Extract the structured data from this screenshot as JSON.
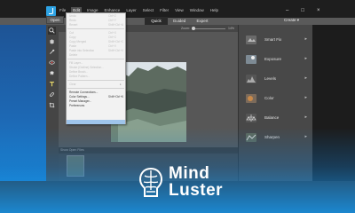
{
  "menubar": {
    "items": [
      "File",
      "Edit",
      "Image",
      "Enhance",
      "Layer",
      "Select",
      "Filter",
      "View",
      "Window",
      "Help"
    ],
    "active_index": 1
  },
  "mode": {
    "open_label": "Open",
    "tabs": [
      "Quick",
      "Guided",
      "Expert"
    ],
    "selected_tab": "Quick",
    "create_label": "Create ▾"
  },
  "options": {
    "zoom_label": "Zoom:",
    "zoom_value": "14%"
  },
  "edit_menu": [
    {
      "label": "Undo",
      "shortcut": "Ctrl+Z",
      "enabled": false
    },
    {
      "label": "Redo",
      "shortcut": "Ctrl+Y",
      "enabled": false
    },
    {
      "label": "Revert",
      "shortcut": "Shift+Ctrl+A",
      "enabled": false
    },
    {
      "label": "Cut",
      "shortcut": "Ctrl+X",
      "enabled": false
    },
    {
      "label": "Copy",
      "shortcut": "Ctrl+C",
      "enabled": false
    },
    {
      "label": "Copy Merged",
      "shortcut": "Shift+Ctrl+C",
      "enabled": false
    },
    {
      "label": "Paste",
      "shortcut": "Ctrl+V",
      "enabled": false
    },
    {
      "label": "Paste into Selection",
      "shortcut": "Shift+Ctrl+V",
      "enabled": false
    },
    {
      "label": "Delete",
      "shortcut": "",
      "enabled": false
    },
    {
      "label": "Fill Layer...",
      "shortcut": "",
      "enabled": false
    },
    {
      "label": "Stroke (Outline) Selection...",
      "shortcut": "",
      "enabled": false
    },
    {
      "label": "Define Brush...",
      "shortcut": "",
      "enabled": false
    },
    {
      "label": "Define Pattern...",
      "shortcut": "",
      "enabled": false
    },
    {
      "label": "Clear",
      "shortcut": "",
      "enabled": false
    },
    {
      "label": "Remote Connections...",
      "shortcut": "",
      "enabled": true
    },
    {
      "label": "Color Settings...",
      "shortcut": "Shift+Ctrl+K",
      "enabled": true
    },
    {
      "label": "Preset Manager...",
      "shortcut": "",
      "enabled": true
    },
    {
      "label": "Preferences",
      "shortcut": "",
      "enabled": true
    }
  ],
  "photobin": {
    "label": "Show Open Files"
  },
  "adjustments": [
    {
      "label": "Smart Fix",
      "icon": "smart-fix-icon"
    },
    {
      "label": "Exposure",
      "icon": "exposure-icon"
    },
    {
      "label": "Levels",
      "icon": "levels-icon"
    },
    {
      "label": "Color",
      "icon": "color-icon"
    },
    {
      "label": "Balance",
      "icon": "balance-icon"
    },
    {
      "label": "Sharpen",
      "icon": "sharpen-icon"
    }
  ],
  "brand": {
    "title": "Mind",
    "subtitle": "Luster"
  },
  "colors": {
    "accent": "#2ea3e4",
    "menu_highlight": "#9fc4ea",
    "overlay_blue": "#1896eb"
  }
}
